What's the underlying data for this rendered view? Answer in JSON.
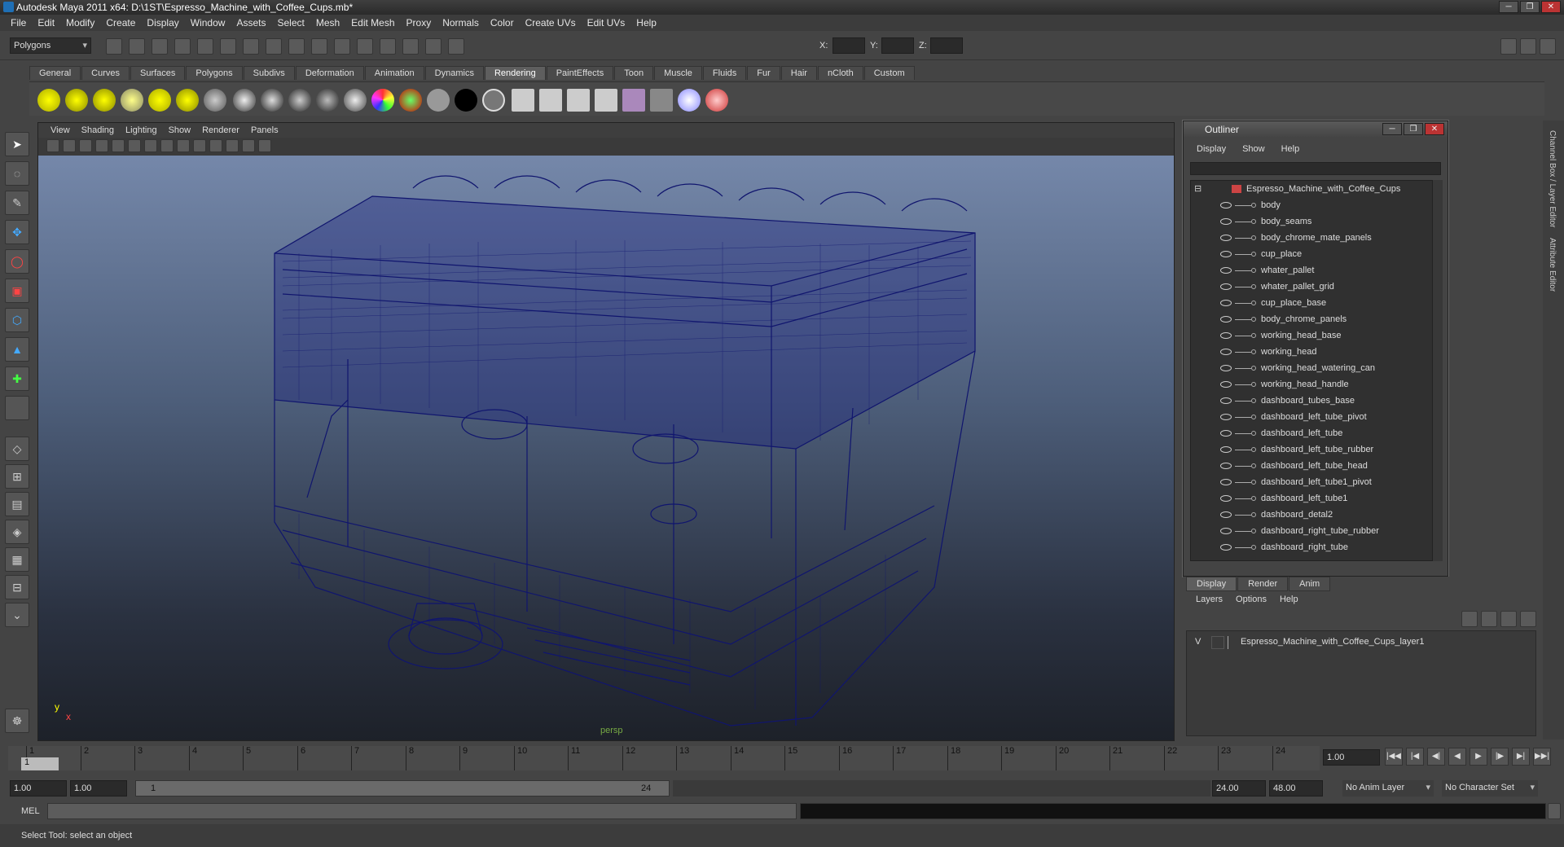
{
  "window": {
    "title": "Autodesk Maya 2011 x64: D:\\1ST\\Espresso_Machine_with_Coffee_Cups.mb*",
    "buttons": [
      "─",
      "❐",
      "✕"
    ]
  },
  "menubar": [
    "File",
    "Edit",
    "Modify",
    "Create",
    "Display",
    "Window",
    "Assets",
    "Select",
    "Mesh",
    "Edit Mesh",
    "Proxy",
    "Normals",
    "Color",
    "Create UVs",
    "Edit UVs",
    "Help"
  ],
  "status": {
    "mode": "Polygons",
    "x_label": "X:",
    "y_label": "Y:",
    "z_label": "Z:"
  },
  "shelf_tabs": [
    "General",
    "Curves",
    "Surfaces",
    "Polygons",
    "Subdivs",
    "Deformation",
    "Animation",
    "Dynamics",
    "Rendering",
    "PaintEffects",
    "Toon",
    "Muscle",
    "Fluids",
    "Fur",
    "Hair",
    "nCloth",
    "Custom"
  ],
  "active_shelf": "Rendering",
  "viewport": {
    "menu": [
      "View",
      "Shading",
      "Lighting",
      "Show",
      "Renderer",
      "Panels"
    ],
    "camera_label": "persp",
    "axis_y": "y",
    "axis_x": "x"
  },
  "outliner": {
    "title": "Outliner",
    "menu": [
      "Display",
      "Show",
      "Help"
    ],
    "root": "Espresso_Machine_with_Coffee_Cups",
    "items": [
      "body",
      "body_seams",
      "body_chrome_mate_panels",
      "cup_place",
      "whater_pallet",
      "whater_pallet_grid",
      "cup_place_base",
      "body_chrome_panels",
      "working_head_base",
      "working_head",
      "working_head_watering_can",
      "working_head_handle",
      "dashboard_tubes_base",
      "dashboard_left_tube_pivot",
      "dashboard_left_tube",
      "dashboard_left_tube_rubber",
      "dashboard_left_tube_head",
      "dashboard_left_tube1_pivot",
      "dashboard_left_tube1",
      "dashboard_detal2",
      "dashboard_right_tube_rubber",
      "dashboard_right_tube"
    ]
  },
  "layer_editor": {
    "tabs": [
      "Display",
      "Render",
      "Anim"
    ],
    "menu": [
      "Layers",
      "Options",
      "Help"
    ],
    "layer_visible": "V",
    "layer_name": "Espresso_Machine_with_Coffee_Cups_layer1"
  },
  "side_tabs": [
    "Channel Box / Layer Editor",
    "Attribute Editor"
  ],
  "timeline": {
    "ticks": [
      "1",
      "2",
      "3",
      "4",
      "5",
      "6",
      "7",
      "8",
      "9",
      "10",
      "11",
      "12",
      "13",
      "14",
      "15",
      "16",
      "17",
      "18",
      "19",
      "20",
      "21",
      "22",
      "23",
      "24"
    ],
    "current_frame": "1",
    "current_field": "1.00"
  },
  "range": {
    "start": "1.00",
    "start2": "1.00",
    "slider_start": "1",
    "slider_end": "24",
    "end": "24.00",
    "end2": "48.00",
    "anim_layer": "No Anim Layer",
    "char_set": "No Character Set"
  },
  "command": {
    "label": "MEL"
  },
  "help": {
    "text": "Select Tool: select an object"
  },
  "colors": {
    "wire": "#10156e",
    "bg_top": "#7a8db0",
    "bg_bottom": "#1d2129"
  }
}
